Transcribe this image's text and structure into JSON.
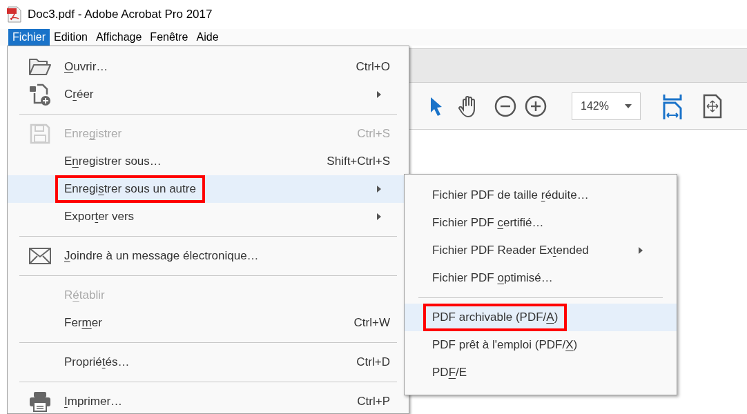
{
  "window": {
    "title": "Doc3.pdf - Adobe Acrobat Pro 2017"
  },
  "menubar": [
    {
      "label": "Fichier",
      "selected": true
    },
    {
      "label": "Edition",
      "selected": false
    },
    {
      "label": "Affichage",
      "selected": false
    },
    {
      "label": "Fenêtre",
      "selected": false
    },
    {
      "label": "Aide",
      "selected": false
    }
  ],
  "toolbar": {
    "zoom": "142%"
  },
  "file_menu": [
    {
      "kind": "item",
      "label": {
        "key": "O",
        "after": "uvrir…"
      },
      "shortcut": "Ctrl+O",
      "submenu": false,
      "disabled": false,
      "selected": false,
      "boxed": false
    },
    {
      "kind": "item",
      "label": {
        "before": "C",
        "key": "r",
        "after": "éer"
      },
      "submenu": true,
      "disabled": false,
      "selected": false,
      "boxed": false
    },
    {
      "kind": "separator"
    },
    {
      "kind": "item",
      "label": {
        "before": "Enre",
        "key": "g",
        "after": "istrer"
      },
      "shortcut": "Ctrl+S",
      "submenu": false,
      "disabled": true,
      "selected": false,
      "boxed": false
    },
    {
      "kind": "item",
      "label": {
        "before": "E",
        "key": "n",
        "after": "registrer sous…"
      },
      "shortcut": "Shift+Ctrl+S",
      "submenu": false,
      "disabled": false,
      "selected": false,
      "boxed": false
    },
    {
      "kind": "item",
      "label": {
        "before": "Enregi",
        "key": "s",
        "after": "trer sous un autre"
      },
      "submenu": true,
      "disabled": false,
      "selected": true,
      "boxed": true
    },
    {
      "kind": "item",
      "label": {
        "before": "Expor",
        "key": "t",
        "after": "er vers"
      },
      "submenu": true,
      "disabled": false,
      "selected": false,
      "boxed": false
    },
    {
      "kind": "separator"
    },
    {
      "kind": "item",
      "label": {
        "key": "J",
        "after": "oindre à un message électronique…"
      },
      "submenu": false,
      "disabled": false,
      "selected": false,
      "boxed": false
    },
    {
      "kind": "separator"
    },
    {
      "kind": "item",
      "label": {
        "before": "R",
        "key": "é",
        "after": "tablir"
      },
      "submenu": false,
      "disabled": true,
      "selected": false,
      "boxed": false
    },
    {
      "kind": "item",
      "label": {
        "before": "Fer",
        "key": "m",
        "after": "er"
      },
      "shortcut": "Ctrl+W",
      "submenu": false,
      "disabled": false,
      "selected": false,
      "boxed": false
    },
    {
      "kind": "separator"
    },
    {
      "kind": "item",
      "label": {
        "before": "Proprié",
        "key": "t",
        "after": "és…"
      },
      "shortcut": "Ctrl+D",
      "submenu": false,
      "disabled": false,
      "selected": false,
      "boxed": false
    },
    {
      "kind": "separator"
    },
    {
      "kind": "item",
      "label": {
        "key": "I",
        "after": "mprimer…"
      },
      "shortcut": "Ctrl+P",
      "submenu": false,
      "disabled": false,
      "selected": false,
      "boxed": false
    }
  ],
  "save_as_other_submenu": [
    {
      "kind": "item",
      "label": {
        "before": "Fichier PDF de taille ",
        "key": "r",
        "after": "éduite…"
      },
      "submenu": false,
      "selected": false,
      "boxed": false
    },
    {
      "kind": "item",
      "label": {
        "before": "Fichier PDF ",
        "key": "c",
        "after": "ertifié…"
      },
      "submenu": false,
      "selected": false,
      "boxed": false
    },
    {
      "kind": "item",
      "label": {
        "before": "Fichier PDF Reader Ex",
        "key": "t",
        "after": "ended"
      },
      "submenu": true,
      "selected": false,
      "boxed": false
    },
    {
      "kind": "item",
      "label": {
        "before": "Fichier PDF ",
        "key": "o",
        "after": "ptimisé…"
      },
      "submenu": false,
      "selected": false,
      "boxed": false
    },
    {
      "kind": "separator"
    },
    {
      "kind": "item",
      "label": {
        "before": "PDF archivable (PDF/",
        "key": "A",
        "after": ")"
      },
      "submenu": false,
      "selected": true,
      "boxed": true
    },
    {
      "kind": "item",
      "label": {
        "before": "PDF prêt à l'emploi (PDF/",
        "key": "X",
        "after": ")"
      },
      "submenu": false,
      "selected": false,
      "boxed": false
    },
    {
      "kind": "item",
      "label": {
        "before": "PD",
        "key": "F",
        "after": "/E"
      },
      "submenu": false,
      "selected": false,
      "boxed": false
    }
  ]
}
